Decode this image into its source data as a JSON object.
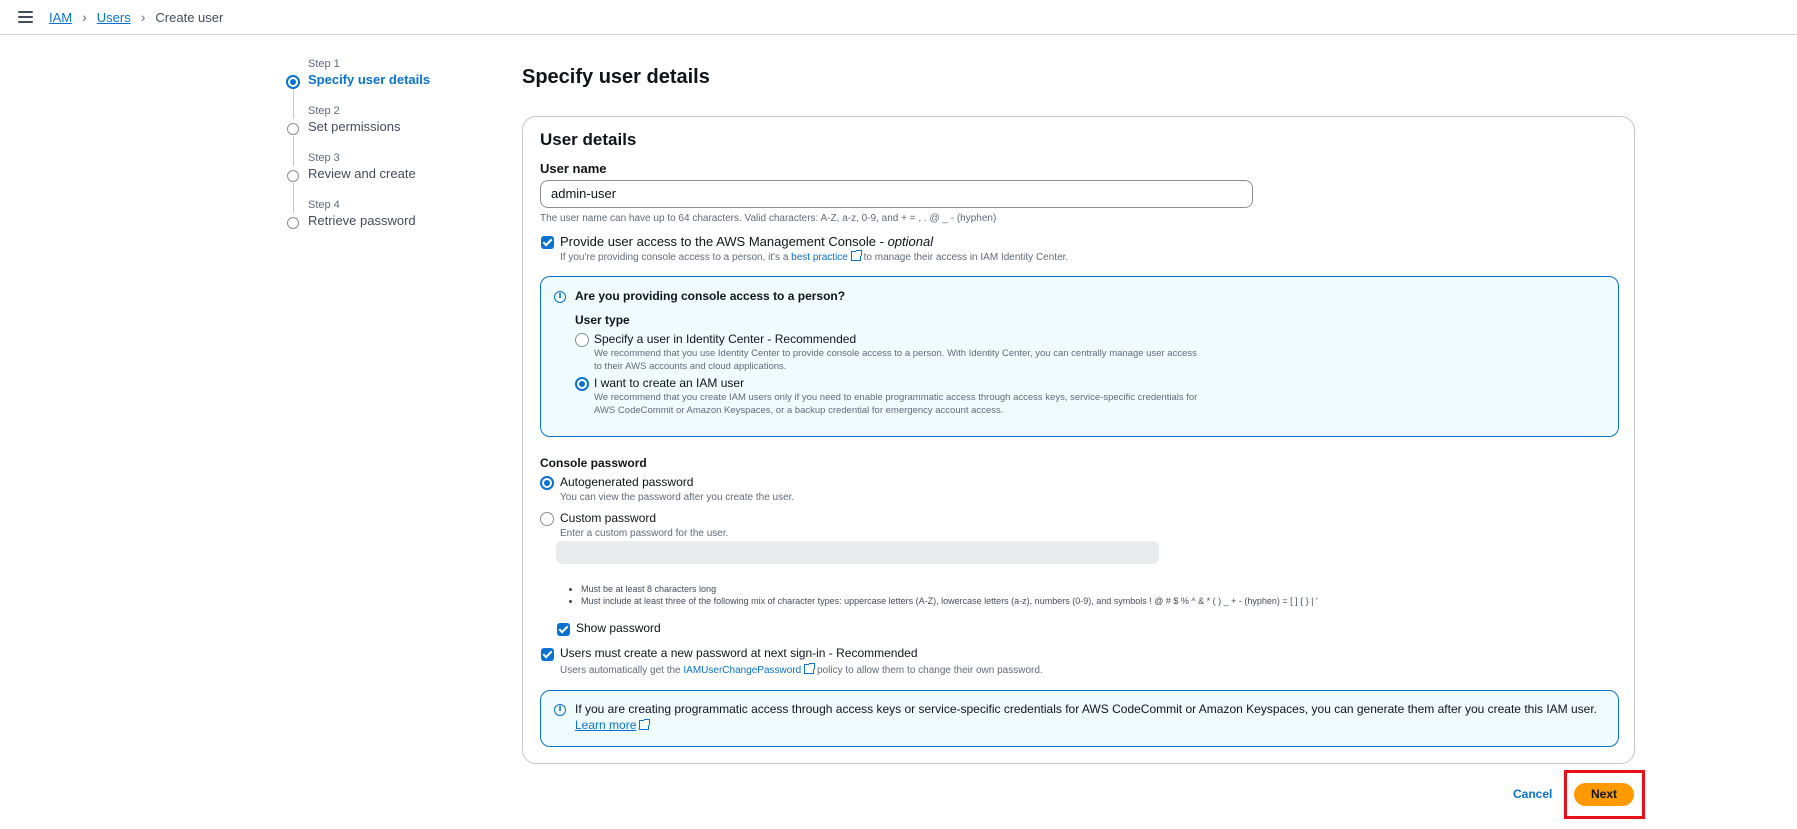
{
  "breadcrumb": {
    "items": [
      "IAM",
      "Users"
    ],
    "current": "Create user"
  },
  "steps": [
    {
      "number": "Step 1",
      "label": "Specify user details",
      "active": true
    },
    {
      "number": "Step 2",
      "label": "Set permissions",
      "active": false
    },
    {
      "number": "Step 3",
      "label": "Review and create",
      "active": false
    },
    {
      "number": "Step 4",
      "label": "Retrieve password",
      "active": false
    }
  ],
  "page_title": "Specify user details",
  "user_details": {
    "title": "User details",
    "username_label": "User name",
    "username_value": "admin-user",
    "username_hint": "The user name can have up to 64 characters. Valid characters: A-Z, a-z, 0-9, and + = , . @ _ - (hyphen)",
    "console_access_label": "Provide user access to the AWS Management Console - ",
    "console_access_optional": "optional",
    "console_access_checked": true,
    "console_hint_pre": "If you're providing console access to a person, it's a ",
    "console_hint_link": "best practice",
    "console_hint_post": " to manage their access in IAM Identity Center."
  },
  "person_box": {
    "title": "Are you providing console access to a person?",
    "user_type_label": "User type",
    "option1_label": "Specify a user in Identity Center - Recommended",
    "option1_desc1": "We recommend that you use Identity Center to provide console access to a person. With Identity Center, you can centrally manage user access",
    "option1_desc2": "to their AWS accounts and cloud applications.",
    "option2_label": "I want to create an IAM user",
    "option2_desc1": "We recommend that you create IAM users only if you need to enable programmatic access through access keys, service-specific credentials for",
    "option2_desc2": "AWS CodeCommit or Amazon Keyspaces, or a backup credential for emergency account access.",
    "selected": "I want to create an IAM user"
  },
  "password": {
    "section_label": "Console password",
    "auto_label": "Autogenerated password",
    "auto_hint": "You can view the password after you create the user.",
    "custom_label": "Custom password",
    "custom_hint": "Enter a custom password for the user.",
    "custom_value": "",
    "rule1": "Must be at least 8 characters long",
    "rule2": "Must include at least three of the following mix of character types: uppercase letters (A-Z), lowercase letters (a-z), numbers (0-9), and symbols ! @ # $ % ^ & * ( ) _ + - (hyphen) = [ ] { } | '",
    "show_password_label": "Show password",
    "show_password_checked": true,
    "reset_label": "Users must create a new password at next sign-in - Recommended",
    "reset_checked": true,
    "reset_hint_pre": "Users automatically get the ",
    "reset_hint_link": "IAMUserChangePassword",
    "reset_hint_post": " policy to allow them to change their own password.",
    "selected": "Autogenerated password"
  },
  "programmatic_box": {
    "text": "If you are creating programmatic access through access keys or service-specific credentials for AWS CodeCommit or Amazon Keyspaces, you can generate them after you create this IAM user.",
    "link": "Learn more"
  },
  "actions": {
    "cancel": "Cancel",
    "next": "Next"
  },
  "colors": {
    "accent": "#0972d3",
    "primary_button": "#ff9900",
    "highlight_box": "#e8101b",
    "info_bg": "#f0fbff"
  },
  "icons": [
    "menu-icon",
    "chevron-right-icon",
    "info-icon",
    "external-link-icon"
  ]
}
